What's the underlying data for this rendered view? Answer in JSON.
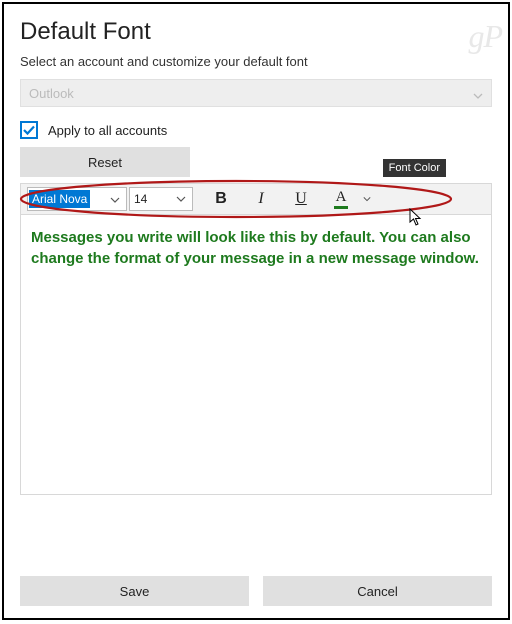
{
  "watermark": "gP",
  "title": "Default Font",
  "subtitle": "Select an account and customize your default font",
  "account_dropdown": {
    "selected": "Outlook"
  },
  "apply_all": {
    "label": "Apply to all accounts",
    "checked": true
  },
  "reset_label": "Reset",
  "toolbar": {
    "font_name": "Arial Nova",
    "font_size": "14",
    "bold": "B",
    "italic": "I",
    "underline": "U",
    "font_color_glyph": "A",
    "tooltip": "Font Color"
  },
  "preview_text": "Messages you write will look like this by default. You can also change the format of your message in a new message window.",
  "preview_color": "#1e7a1e",
  "footer": {
    "save": "Save",
    "cancel": "Cancel"
  }
}
